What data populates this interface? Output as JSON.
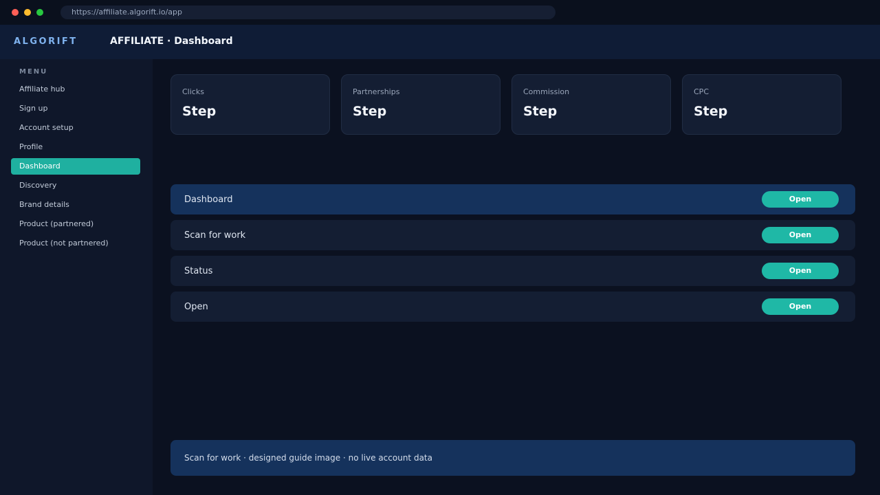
{
  "browser": {
    "url": "https://affiliate.algorift.io/app"
  },
  "header": {
    "brand": "ALGORIFT",
    "title": "AFFILIATE · Dashboard"
  },
  "sidebar": {
    "heading": "MENU",
    "items": [
      {
        "label": "Affiliate hub"
      },
      {
        "label": "Sign up"
      },
      {
        "label": "Account setup"
      },
      {
        "label": "Profile"
      },
      {
        "label": "Dashboard",
        "active": true
      },
      {
        "label": "Discovery"
      },
      {
        "label": "Brand details"
      },
      {
        "label": "Product (partnered)"
      },
      {
        "label": "Product (not partnered)"
      }
    ]
  },
  "stats": [
    {
      "label": "Clicks",
      "value": "Step"
    },
    {
      "label": "Partnerships",
      "value": "Step"
    },
    {
      "label": "Commission",
      "value": "Step"
    },
    {
      "label": "CPC",
      "value": "Step"
    }
  ],
  "rows": [
    {
      "label": "Dashboard",
      "button": "Open",
      "highlight": true
    },
    {
      "label": "Scan for work",
      "button": "Open"
    },
    {
      "label": "Status",
      "button": "Open"
    },
    {
      "label": "Open",
      "button": "Open"
    }
  ],
  "footer": {
    "note": "Scan for work · designed guide image · no live account data"
  },
  "colors": {
    "accent": "#1fb0a0",
    "highlight": "#15325c",
    "brand": "#7fb2ee"
  },
  "icons": [
    "window-close-dot",
    "window-minimize-dot",
    "window-maximize-dot"
  ]
}
